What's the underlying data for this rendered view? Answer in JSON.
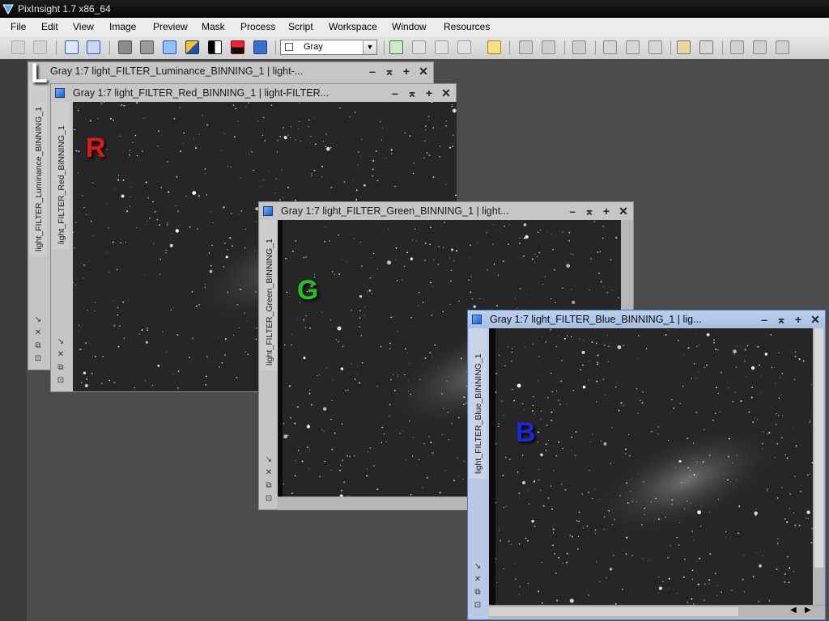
{
  "app": {
    "title": "PixInsight 1.7 x86_64"
  },
  "menu": [
    "File",
    "Edit",
    "View",
    "Image",
    "Preview",
    "Mask",
    "Process",
    "Script",
    "Workspace",
    "Window",
    "Resources"
  ],
  "toolbar": {
    "stf_mode": "Gray"
  },
  "windows": {
    "luminance": {
      "title": "Gray 1:7 light_FILTER_Luminance_BINNING_1 | light-...",
      "tab": "light_FILTER_Luminance_BINNING_1",
      "marker": "L"
    },
    "red": {
      "title": "Gray 1:7 light_FILTER_Red_BINNING_1 | light-FILTER...",
      "tab": "light_FILTER_Red_BINNING_1",
      "marker": "R"
    },
    "green": {
      "title": "Gray 1:7 light_FILTER_Green_BINNING_1 | light...",
      "tab": "light_FILTER_Green_BINNING_1",
      "marker": "G"
    },
    "blue": {
      "title": "Gray 1:7 light_FILTER_Blue_BINNING_1 | lig...",
      "tab": "light_FILTER_Blue_BINNING_1",
      "marker": "B"
    }
  },
  "icons": {
    "window_buttons": [
      "minimize-icon",
      "shade-icon",
      "maximize-icon",
      "close-icon"
    ],
    "side_tools": [
      "zoom-fit-icon",
      "pan-icon",
      "new-preview-icon",
      "fit-window-icon"
    ]
  },
  "colors": {
    "marker_red": "#e01818",
    "marker_green": "#22c41e",
    "marker_blue": "#1a2ad8",
    "marker_white": "#ffffff",
    "active_title": "#b0c4e8"
  }
}
